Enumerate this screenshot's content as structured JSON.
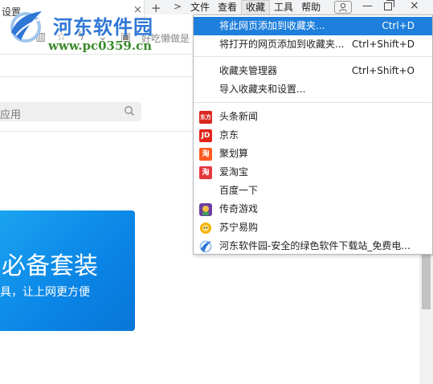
{
  "tab": {
    "title": "设置",
    "close_glyph": "×",
    "new_glyph": "+",
    "arrow_glyph": ">"
  },
  "menu": [
    "文件",
    "查看",
    "收藏",
    "工具",
    "帮助"
  ],
  "window_buttons": {
    "minimize": "—",
    "close": "×"
  },
  "toolbar": {
    "search_hint": "好吃懒做是"
  },
  "watermark": {
    "name": "河东软件园",
    "url": "www.pc0359.cn"
  },
  "page": {
    "search_placeholder": "应用",
    "banner_title": "必备套装",
    "banner_subtitle": "具，让上网更方便"
  },
  "favorites_menu": {
    "actions": [
      {
        "label": "将此网页添加到收藏夹...",
        "shortcut": "Ctrl+D",
        "highlighted": true
      },
      {
        "label": "将打开的网页添加到收藏夹...",
        "shortcut": "Ctrl+Shift+D",
        "highlighted": false
      }
    ],
    "manage": [
      {
        "label": "收藏夹管理器",
        "shortcut": "Ctrl+Shift+O"
      },
      {
        "label": "导入收藏夹和设置...",
        "shortcut": ""
      }
    ],
    "bookmarks": [
      {
        "label": "头条新闻",
        "icon": "news-icon",
        "icon_text": "东方",
        "color": "#d8261c"
      },
      {
        "label": "京东",
        "icon": "jd-icon",
        "icon_text": "JD",
        "color": "#e1251b"
      },
      {
        "label": "聚划算",
        "icon": "juhuasuan-icon",
        "icon_text": "淘",
        "color": "#ff5a1f"
      },
      {
        "label": "爱淘宝",
        "icon": "aitaobao-icon",
        "icon_text": "淘",
        "color": "#e4393c"
      },
      {
        "label": "百度一下",
        "icon": "",
        "icon_text": "",
        "color": ""
      },
      {
        "label": "传奇游戏",
        "icon": "game-icon",
        "icon_text": "",
        "color": "#6a3fa0"
      },
      {
        "label": "苏宁易购",
        "icon": "suning-icon",
        "icon_text": "",
        "color": "#f5b400"
      },
      {
        "label": "河东软件园-安全的绿色软件下载站_免费电...",
        "icon": "hedong-icon",
        "icon_text": "",
        "color": "#2f77d6"
      }
    ]
  },
  "colors": {
    "highlight": "#1e7fdc",
    "watermark_blue": "#2f77d6",
    "watermark_green": "#3a8a2a",
    "banner": "#0a84e6"
  }
}
